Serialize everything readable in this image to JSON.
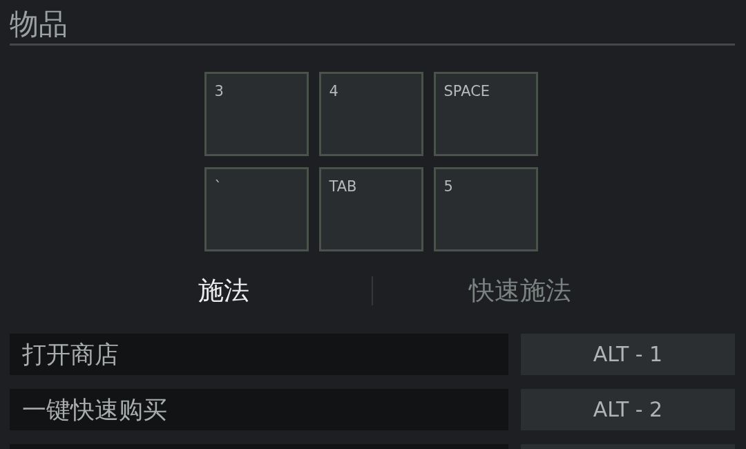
{
  "section": {
    "title": "物品"
  },
  "item_slots": [
    {
      "key": "3"
    },
    {
      "key": "4"
    },
    {
      "key": "SPACE"
    },
    {
      "key": "`"
    },
    {
      "key": "TAB"
    },
    {
      "key": "5"
    }
  ],
  "tabs": [
    {
      "label": "施法",
      "selected": true
    },
    {
      "label": "快速施法",
      "selected": false
    }
  ],
  "hotkeys": [
    {
      "label": "打开商店",
      "key": "ALT - 1"
    },
    {
      "label": "一键快速购买",
      "key": "ALT - 2"
    }
  ]
}
